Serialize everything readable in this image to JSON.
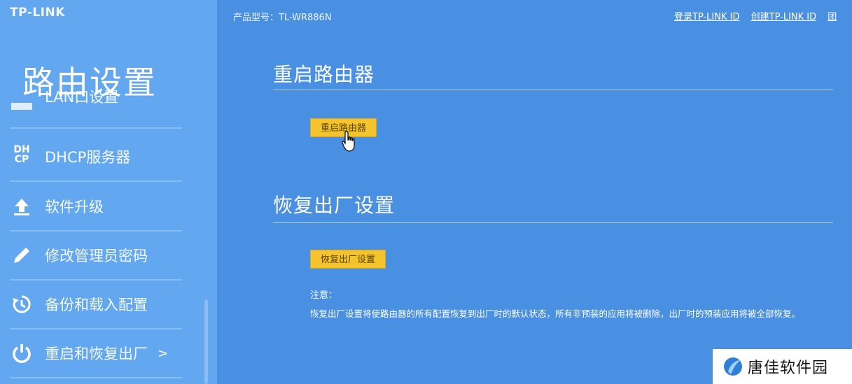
{
  "brand": "TP-LINK",
  "sidebar": {
    "section_title": "路由设置",
    "items": [
      {
        "label": "LAN口设置",
        "icon": "lan-icon"
      },
      {
        "label": "DHCP服务器",
        "icon": "dhcp-icon",
        "icon_text": "DH CP"
      },
      {
        "label": "软件升级",
        "icon": "upload-icon"
      },
      {
        "label": "修改管理员密码",
        "icon": "pencil-icon"
      },
      {
        "label": "备份和载入配置",
        "icon": "history-icon"
      },
      {
        "label": "重启和恢复出厂",
        "icon": "power-icon",
        "chevron": ">"
      }
    ]
  },
  "topbar": {
    "model": "产品型号：TL-WR886N",
    "login_link": "登录TP-LINK ID",
    "create_link": "创建TP-LINK ID",
    "extra_link": "团"
  },
  "reboot": {
    "heading": "重启路由器",
    "button": "重启路由器"
  },
  "restore": {
    "heading": "恢复出厂设置",
    "button": "恢复出厂设置",
    "note_title": "注意：",
    "note_body": "恢复出厂设置将使路由器的所有配置恢复到出厂时的默认状态，所有非预装的应用将被删除，出厂时的预装应用将被全部恢复。"
  },
  "watermark": {
    "text": "唐佳软件园"
  },
  "colors": {
    "main_bg": "#4a90e2",
    "sidebar_bg": "#62a7ef",
    "button": "#f5c42c"
  }
}
